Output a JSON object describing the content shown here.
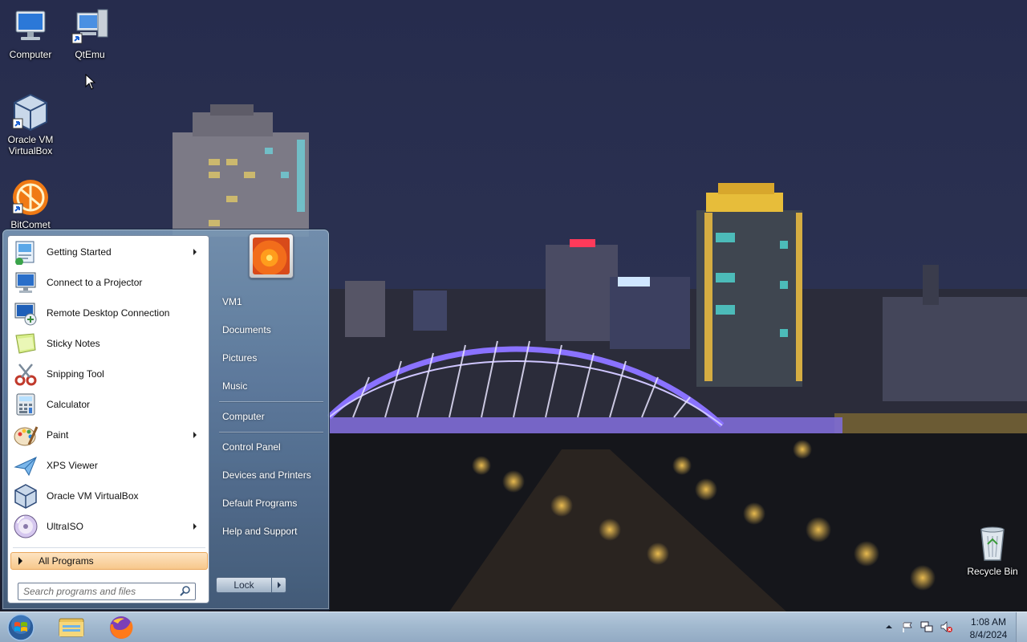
{
  "desktop": {
    "icons": [
      {
        "label": "Computer",
        "icon": "computer-icon"
      },
      {
        "label": "QtEmu",
        "icon": "qtemu-icon"
      },
      {
        "label": "Oracle VM VirtualBox",
        "icon": "virtualbox-icon"
      },
      {
        "label": "BitComet",
        "icon": "bitcomet-icon"
      },
      {
        "label": "Recycle Bin",
        "icon": "recycle-bin-icon"
      }
    ]
  },
  "start_menu": {
    "programs": [
      {
        "label": "Getting Started",
        "icon": "getting-started-icon",
        "has_submenu": true
      },
      {
        "label": "Connect to a Projector",
        "icon": "projector-icon",
        "has_submenu": false
      },
      {
        "label": "Remote Desktop Connection",
        "icon": "remote-desktop-icon",
        "has_submenu": false
      },
      {
        "label": "Sticky Notes",
        "icon": "sticky-notes-icon",
        "has_submenu": false
      },
      {
        "label": "Snipping Tool",
        "icon": "snipping-tool-icon",
        "has_submenu": false
      },
      {
        "label": "Calculator",
        "icon": "calculator-icon",
        "has_submenu": false
      },
      {
        "label": "Paint",
        "icon": "paint-icon",
        "has_submenu": true
      },
      {
        "label": "XPS Viewer",
        "icon": "xps-viewer-icon",
        "has_submenu": false
      },
      {
        "label": "Oracle VM VirtualBox",
        "icon": "virtualbox-icon",
        "has_submenu": false
      },
      {
        "label": "UltraISO",
        "icon": "ultraiso-icon",
        "has_submenu": true
      }
    ],
    "all_programs_label": "All Programs",
    "search_placeholder": "Search programs and files",
    "places": [
      "VM1",
      "Documents",
      "Pictures",
      "Music",
      "Computer",
      "Control Panel",
      "Devices and Printers",
      "Default Programs",
      "Help and Support"
    ],
    "lock_label": "Lock"
  },
  "taskbar": {
    "pinned": [
      "start-orb-icon",
      "windows-explorer-icon",
      "firefox-icon"
    ],
    "tray_icons": [
      "show-hidden-icons",
      "action-center-flag-icon",
      "network-icon",
      "volume-muted-icon"
    ],
    "clock_time": "1:08 AM",
    "clock_date": "8/4/2024"
  }
}
